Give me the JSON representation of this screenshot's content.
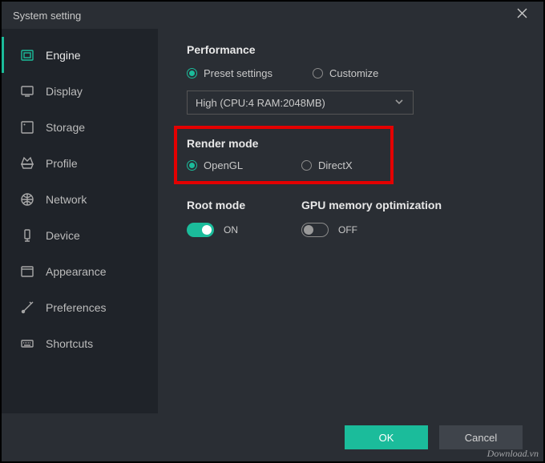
{
  "window": {
    "title": "System setting"
  },
  "sidebar": {
    "items": [
      {
        "label": "Engine"
      },
      {
        "label": "Display"
      },
      {
        "label": "Storage"
      },
      {
        "label": "Profile"
      },
      {
        "label": "Network"
      },
      {
        "label": "Device"
      },
      {
        "label": "Appearance"
      },
      {
        "label": "Preferences"
      },
      {
        "label": "Shortcuts"
      }
    ]
  },
  "performance": {
    "title": "Performance",
    "preset_label": "Preset settings",
    "customize_label": "Customize",
    "select_value": "High (CPU:4 RAM:2048MB)"
  },
  "render": {
    "title": "Render mode",
    "opengl_label": "OpenGL",
    "directx_label": "DirectX"
  },
  "root": {
    "title": "Root mode",
    "state_label": "ON"
  },
  "gpu": {
    "title": "GPU memory optimization",
    "state_label": "OFF"
  },
  "footer": {
    "ok_label": "OK",
    "cancel_label": "Cancel"
  },
  "watermark": "Download.vn",
  "colors": {
    "accent": "#1bbc9b",
    "highlight": "#e40000",
    "bg_dark": "#2a2e34",
    "sidebar_bg": "#1f2329"
  }
}
